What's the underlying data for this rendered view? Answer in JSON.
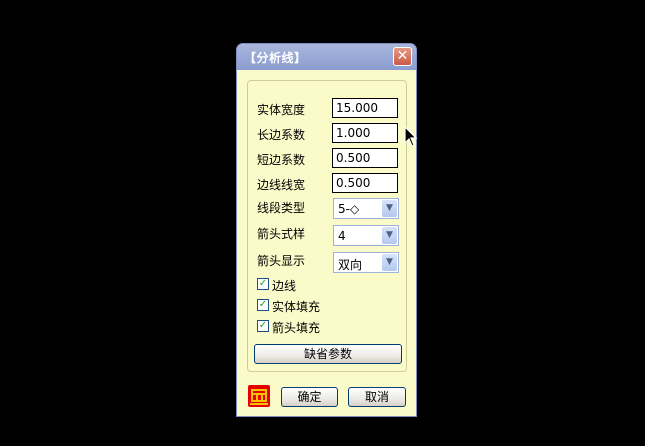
{
  "window": {
    "title": "【分析线】"
  },
  "fields": [
    {
      "label": "实体宽度",
      "value": "15.000"
    },
    {
      "label": "长边系数",
      "value": "1.000"
    },
    {
      "label": "短边系数",
      "value": "0.500"
    },
    {
      "label": "边线线宽",
      "value": "0.500"
    }
  ],
  "selects": [
    {
      "label": "线段类型",
      "value": "5-◇"
    },
    {
      "label": "箭头式样",
      "value": "4"
    },
    {
      "label": "箭头显示",
      "value": "双向"
    }
  ],
  "checkboxes": [
    {
      "label": "边线",
      "checked": true
    },
    {
      "label": "实体填充",
      "checked": true
    },
    {
      "label": "箭头填充",
      "checked": true
    }
  ],
  "buttons": {
    "defaults": "缺省参数",
    "ok": "确定",
    "cancel": "取消"
  },
  "icons": {
    "close": "close-icon",
    "logo": "app-logo-icon",
    "cursor": "mouse-cursor-icon"
  },
  "colors": {
    "background": "#000000",
    "dialog": "#fbfbca",
    "titlebar": "#8a9bcf",
    "close": "#c85a45",
    "logo": "#e60000"
  }
}
